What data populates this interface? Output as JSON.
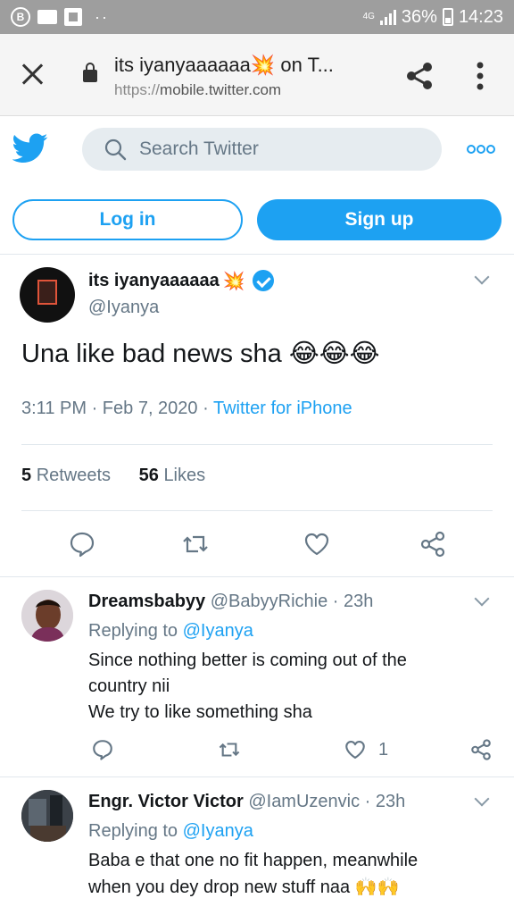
{
  "status_bar": {
    "notif_letter": "B",
    "dots": "··",
    "network": "4G",
    "battery": "36%",
    "time": "14:23"
  },
  "browser": {
    "title": "its iyanyaaaaaa💥 on T...",
    "url_scheme": "https://",
    "url_host": "mobile.twitter.com"
  },
  "header": {
    "search_placeholder": "Search Twitter",
    "login_label": "Log in",
    "signup_label": "Sign up"
  },
  "tweet": {
    "author_name": "its iyanyaaaaaa",
    "author_emoji": "💥",
    "handle": "@Iyanya",
    "text": "Una like bad news sha",
    "text_emoji": "😂😂😂",
    "time": "3:11 PM",
    "dot": "·",
    "date": "Feb 7, 2020",
    "source": "Twitter for iPhone",
    "retweets_count": "5",
    "retweets_label": "Retweets",
    "likes_count": "56",
    "likes_label": "Likes"
  },
  "replies": [
    {
      "name": "Dreamsbabyy",
      "handle": "@BabyyRichie",
      "age": "23h",
      "replying_label": "Replying to",
      "replying_to": "@Iyanya",
      "line1": "Since nothing better is coming out of the",
      "line2": "country nii",
      "line3": "We try to like something sha",
      "likes": "1"
    },
    {
      "name": "Engr. Victor Victor",
      "handle": "@IamUzenvic",
      "age": "23h",
      "replying_label": "Replying to",
      "replying_to": "@Iyanya",
      "line1": "Baba e that one no fit happen, meanwhile",
      "line2": "when you dey drop new stuff naa",
      "line2_emoji": "🙌🙌"
    }
  ],
  "icons": {
    "accent": "#1da1f2",
    "muted": "#657786"
  }
}
